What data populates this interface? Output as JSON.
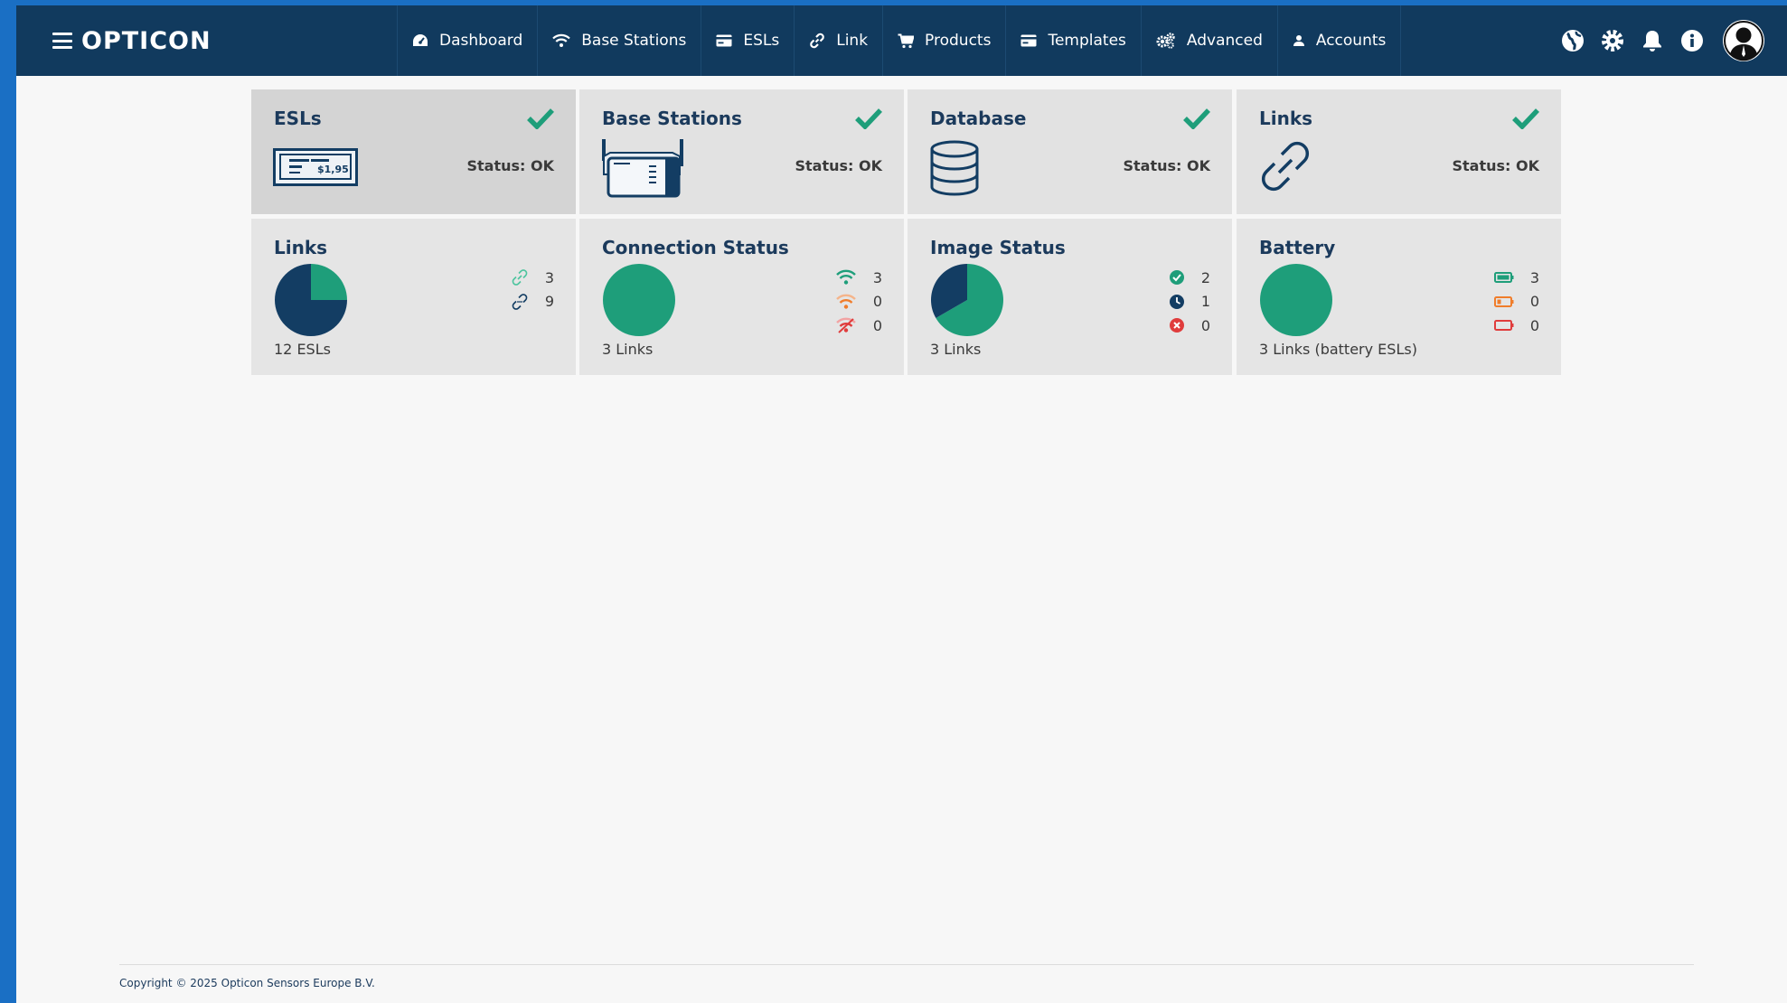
{
  "app": {
    "brand": "OPTICON"
  },
  "nav": {
    "items": [
      {
        "label": "Dashboard",
        "icon": "dashboard-gauge-icon"
      },
      {
        "label": "Base Stations",
        "icon": "wifi-icon"
      },
      {
        "label": "ESLs",
        "icon": "card-icon"
      },
      {
        "label": "Link",
        "icon": "link-icon"
      },
      {
        "label": "Products",
        "icon": "cart-icon"
      },
      {
        "label": "Templates",
        "icon": "template-card-icon"
      },
      {
        "label": "Advanced",
        "icon": "gears-icon"
      },
      {
        "label": "Accounts",
        "icon": "user-icon"
      }
    ],
    "right_icons": [
      "globe-icon",
      "gear-icon",
      "bell-icon",
      "info-icon",
      "avatar"
    ]
  },
  "status_cards": [
    {
      "title": "ESLs",
      "status": "Status: OK",
      "icon": "esl-price-tag-icon",
      "tag_price": "$1,95"
    },
    {
      "title": "Base Stations",
      "status": "Status: OK",
      "icon": "base-station-icon"
    },
    {
      "title": "Database",
      "status": "Status: OK",
      "icon": "database-icon"
    },
    {
      "title": "Links",
      "status": "Status: OK",
      "icon": "chain-link-icon"
    }
  ],
  "summary_cards": [
    {
      "title": "Links",
      "caption": "12 ESLs",
      "pie": [
        {
          "label": "linked",
          "value": 3,
          "color": "#1e9e7a"
        },
        {
          "label": "unlinked",
          "value": 9,
          "color": "#133d63"
        }
      ],
      "legend": [
        {
          "icon": "linked-icon",
          "value": "3"
        },
        {
          "icon": "unlinked-icon",
          "value": "9"
        }
      ]
    },
    {
      "title": "Connection Status",
      "caption": "3 Links",
      "pie": [
        {
          "label": "online",
          "value": 3,
          "color": "#1e9e7a"
        }
      ],
      "legend": [
        {
          "icon": "wifi-good-icon",
          "value": "3"
        },
        {
          "icon": "wifi-weak-icon",
          "value": "0"
        },
        {
          "icon": "wifi-off-icon",
          "value": "0"
        }
      ]
    },
    {
      "title": "Image Status",
      "caption": "3 Links",
      "pie": [
        {
          "label": "ok",
          "value": 2,
          "color": "#1e9e7a"
        },
        {
          "label": "pending",
          "value": 1,
          "color": "#133d63"
        },
        {
          "label": "error",
          "value": 0,
          "color": "#e03c3c"
        }
      ],
      "legend": [
        {
          "icon": "check-circle-icon",
          "value": "2"
        },
        {
          "icon": "clock-icon",
          "value": "1"
        },
        {
          "icon": "error-circle-icon",
          "value": "0"
        }
      ]
    },
    {
      "title": "Battery",
      "caption": "3 Links (battery ESLs)",
      "pie": [
        {
          "label": "good",
          "value": 3,
          "color": "#1e9e7a"
        }
      ],
      "legend": [
        {
          "icon": "battery-full-icon",
          "value": "3"
        },
        {
          "icon": "battery-low-icon",
          "value": "0"
        },
        {
          "icon": "battery-empty-icon",
          "value": "0"
        }
      ]
    }
  ],
  "footer": {
    "copyright": "Copyright © 2025 Opticon Sensors Europe B.V."
  },
  "colors": {
    "navbar": "#113a5e",
    "accent_green": "#1e9e7a",
    "dark_blue": "#133d63",
    "frame_blue": "#1a6fc4",
    "warning_orange": "#f07d2b",
    "error_red": "#e03c3c"
  }
}
